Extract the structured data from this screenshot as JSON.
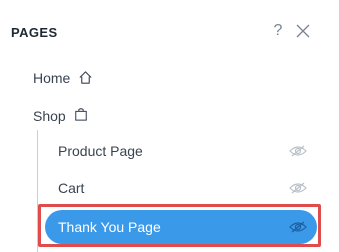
{
  "panel": {
    "title": "PAGES"
  },
  "header_icons": {
    "help": "?",
    "help_icon": "question-icon",
    "close_icon": "close-icon"
  },
  "pages": [
    {
      "label": "Home",
      "icon": "home-icon"
    },
    {
      "label": "Shop",
      "icon": "shopping-bag-icon"
    }
  ],
  "sub_pages": [
    {
      "label": "Product Page",
      "icon": "eye-hidden-icon",
      "selected": false
    },
    {
      "label": "Cart",
      "icon": "eye-hidden-icon",
      "selected": false
    },
    {
      "label": "Thank You Page",
      "icon": "eye-hidden-icon",
      "selected": true
    }
  ],
  "colors": {
    "selected_bg": "#3b99ea",
    "highlight_border": "#e04b4b",
    "text": "#3a4350"
  }
}
